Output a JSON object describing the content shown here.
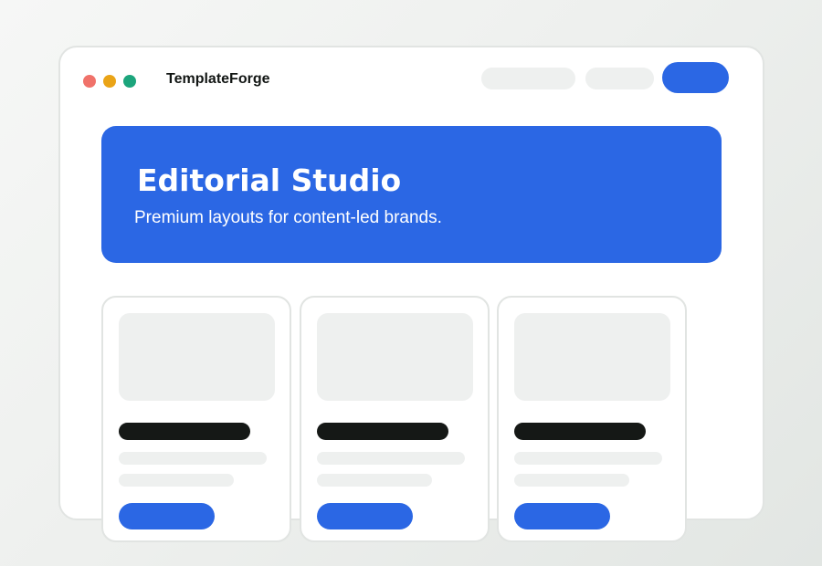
{
  "app": {
    "brand_name": "TemplateForge"
  },
  "window_controls": {
    "dots": [
      {
        "name": "close",
        "color": "#f0726a"
      },
      {
        "name": "minimize",
        "color": "#eaa417"
      },
      {
        "name": "maximize",
        "color": "#1ca57c"
      }
    ]
  },
  "hero": {
    "title": "Editorial Studio",
    "subtitle": "Premium layouts for content-led brands."
  },
  "colors": {
    "accent": "#2b67e4",
    "placeholder": "#eef0ef",
    "heading_bar": "#151816",
    "border": "#e1e4e2"
  }
}
